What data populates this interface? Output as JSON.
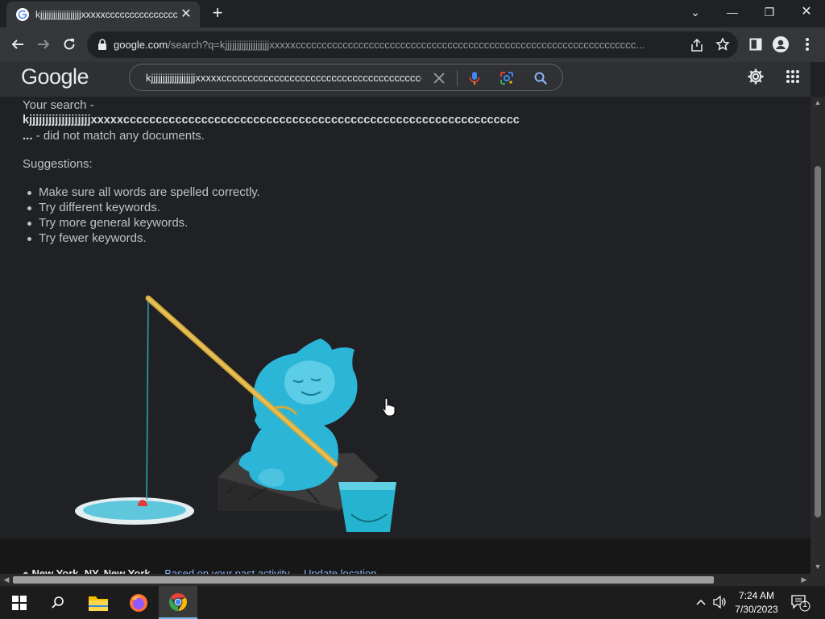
{
  "browser": {
    "tab": {
      "title": "kjjjjjjjjjjjjjjjjjjjxxxxxcccccccccccccccccc",
      "close_glyph": "✕"
    },
    "new_tab_glyph": "+",
    "window_controls": {
      "list": "⌄",
      "minimize": "—",
      "restore": "❐",
      "close": "✕"
    },
    "address": {
      "host": "google.com",
      "path": "/search?q=kjjjjjjjjjjjjjjjjjjjxxxxxccccccccccccccccccccccccccccccccccccccccccccccccccccccccccccccccc..."
    }
  },
  "google": {
    "logo": "Google",
    "query": "kjjjjjjjjjjjjjjjjjjjxxxxxccccccccccccccccccccccccccccccccccccccc"
  },
  "results": {
    "your_search": "Your search -",
    "query_bold": "kjjjjjjjjjjjjjjjjjjjxxxxxccccccccccccccccccccccccccccccccccccccccccccccccccccccccccccc",
    "ellipsis": "...",
    "no_match": " - did not match any documents.",
    "suggestions_heading": "Suggestions:",
    "suggestions": [
      "Make sure all words are spelled correctly.",
      "Try different keywords.",
      "Try more general keywords.",
      "Try fewer keywords."
    ]
  },
  "footer": {
    "location": "New York, NY, New York",
    "separator": " - ",
    "based_on": "Based on your past activity",
    "update": "Update location"
  },
  "taskbar": {
    "time": "7:24 AM",
    "date": "7/30/2023",
    "notification_count": "1"
  },
  "colors": {
    "page_bg": "#202124",
    "text": "#bdc1c6",
    "link": "#8ab4f8",
    "yeti": "#29b6d6"
  }
}
